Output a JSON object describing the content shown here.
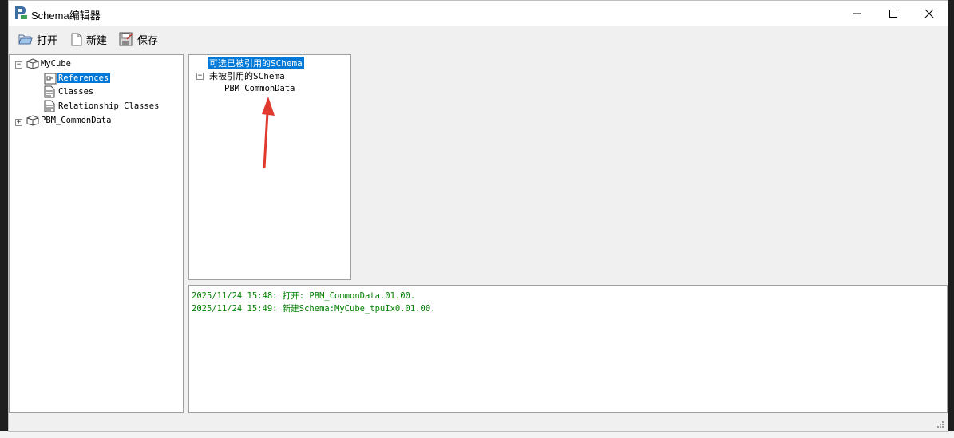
{
  "window": {
    "title": "Schema编辑器"
  },
  "toolbar": {
    "open_label": "打开",
    "new_label": "新建",
    "save_label": "保存"
  },
  "left_tree": {
    "root": "MyCube",
    "children": [
      "References",
      "Classes",
      "Relationship Classes"
    ],
    "second_root": "PBM_CommonData"
  },
  "middle_tree": {
    "referenced_label": "可选已被引用的SChema",
    "unreferenced_label": "未被引用的SChema",
    "unreferenced_items": [
      "PBM_CommonData"
    ]
  },
  "log": {
    "lines": [
      "2025/11/24 15:48: 打开: PBM_CommonData.01.00.",
      "2025/11/24 15:49: 新建Schema:MyCube_tpuIx0.01.00."
    ]
  },
  "colors": {
    "selection": "#0078d7",
    "log_text": "#008000",
    "annotation_arrow": "#e03a2f"
  },
  "icons": [
    "app-icon",
    "open-folder-icon",
    "new-file-icon",
    "save-icon",
    "cube-icon",
    "reference-icon",
    "document-icon",
    "minimize-icon",
    "maximize-icon",
    "close-icon",
    "resize-grip-icon"
  ]
}
